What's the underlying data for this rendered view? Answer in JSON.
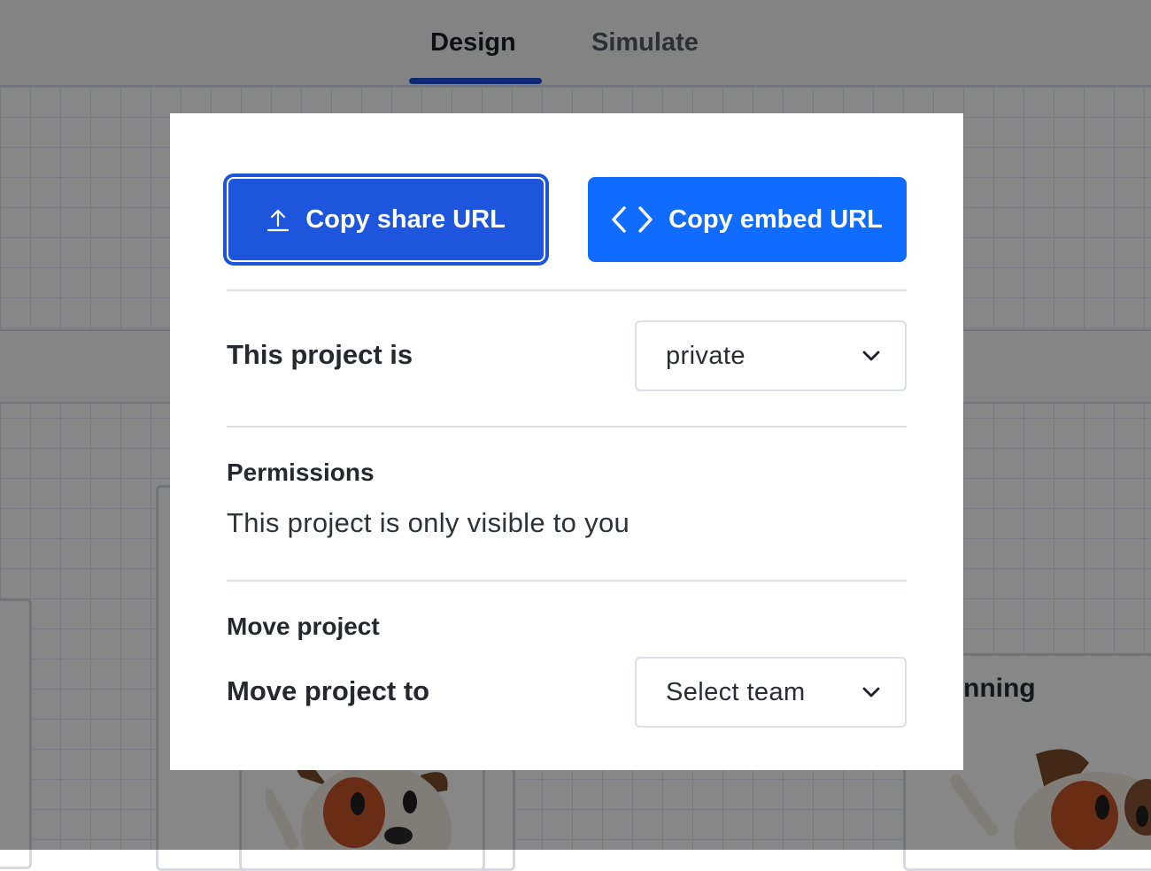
{
  "tabs": [
    {
      "label": "Design",
      "active": true
    },
    {
      "label": "Simulate",
      "active": false
    }
  ],
  "background": {
    "card_label_partial": "nning"
  },
  "modal": {
    "share_button_label": "Copy share URL",
    "share_button_icon": "upload-icon",
    "embed_button_label": "Copy embed URL",
    "embed_button_icon": "code-icon",
    "visibility": {
      "label": "This project is",
      "selected": "private"
    },
    "permissions": {
      "title": "Permissions",
      "description": "This project is only visible to you"
    },
    "move": {
      "title": "Move project",
      "label": "Move project to",
      "placeholder": "Select team"
    }
  },
  "colors": {
    "share_button": "#1d56dd",
    "embed_button": "#0f6cff",
    "tab_underline": "#1b4fd8"
  }
}
